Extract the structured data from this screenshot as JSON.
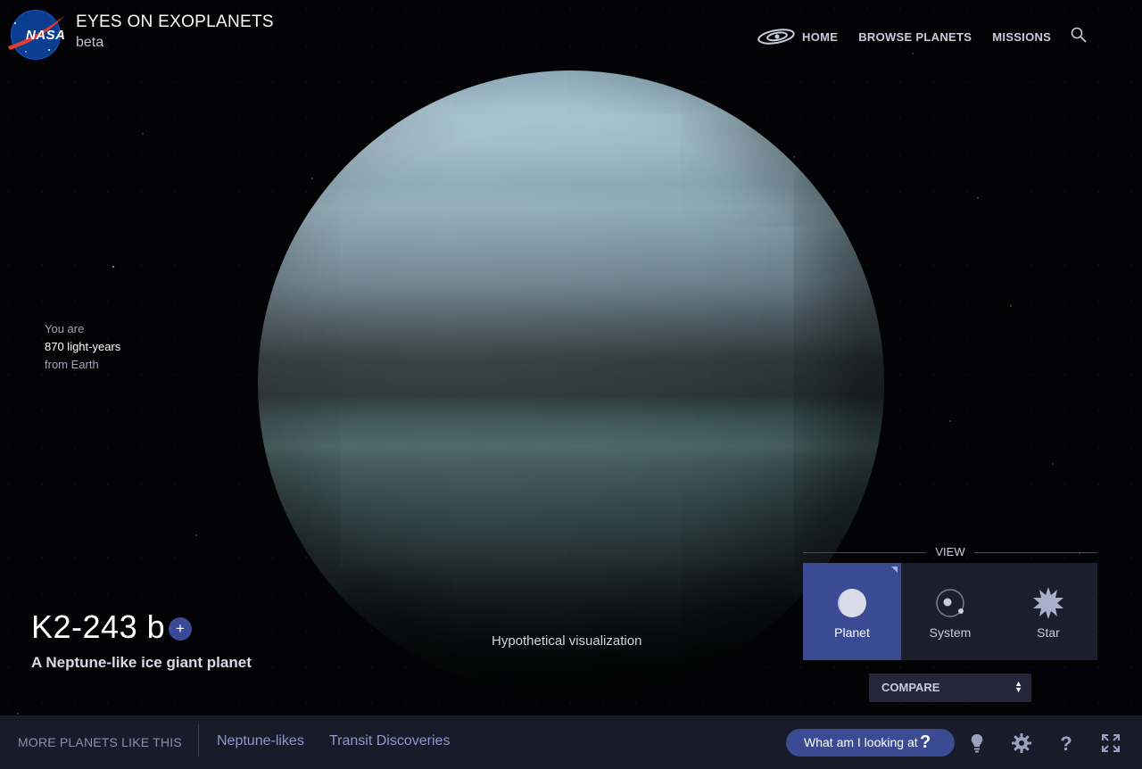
{
  "header": {
    "logo_text": "NASA",
    "title": "EYES ON EXOPLANETS",
    "subtitle": "beta",
    "nav": [
      "HOME",
      "BROWSE PLANETS",
      "MISSIONS"
    ]
  },
  "distance": {
    "line1": "You are",
    "value": "870 light-years",
    "line3": "from Earth"
  },
  "planet": {
    "name": "K2-243 b",
    "add_label": "+",
    "description": "A Neptune-like ice giant planet",
    "visualization_note": "Hypothetical visualization"
  },
  "view": {
    "label": "VIEW",
    "options": [
      "Planet",
      "System",
      "Star"
    ],
    "active": "Planet",
    "compare_label": "COMPARE"
  },
  "footer": {
    "more_label": "MORE PLANETS LIKE THIS",
    "links": [
      "Neptune-likes",
      "Transit Discoveries"
    ],
    "what_label": "What am I looking at",
    "what_icon": "?"
  },
  "colors": {
    "accent": "#3a4b94",
    "footer_bg": "#1a1b29",
    "link": "#8f96d0"
  }
}
